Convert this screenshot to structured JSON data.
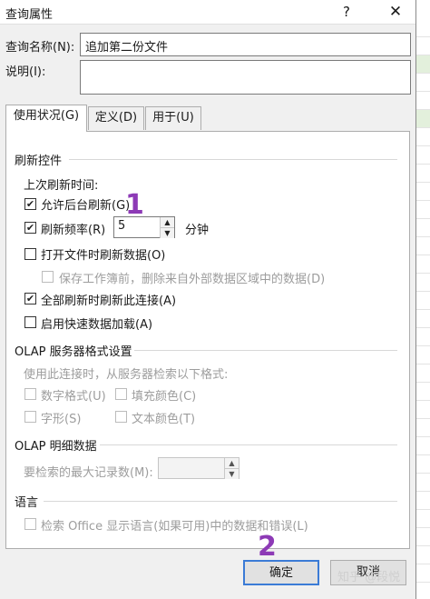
{
  "window": {
    "title": "查询属性",
    "help_label": "?",
    "close_label": "✕"
  },
  "query_name": {
    "label": "查询名称(N):",
    "value": "追加第二份文件"
  },
  "description": {
    "label": "说明(I):",
    "value": ""
  },
  "tabs": [
    {
      "label": "使用状况(G)",
      "active": true
    },
    {
      "label": "定义(D)",
      "active": false
    },
    {
      "label": "用于(U)",
      "active": false
    }
  ],
  "refresh_control": {
    "title": "刷新控件",
    "last_refresh_label": "上次刷新时间:",
    "enable_background_refresh": {
      "label": "允许后台刷新(G)",
      "checked": true
    },
    "refresh_every": {
      "label": "刷新频率(R)",
      "checked": true,
      "value": "5",
      "unit": "分钟"
    },
    "refresh_on_open": {
      "label": "打开文件时刷新数据(O)",
      "checked": false
    },
    "remove_data": {
      "label": "保存工作簿前，删除来自外部数据区域中的数据(D)",
      "checked": false,
      "disabled": true
    },
    "refresh_all": {
      "label": "全部刷新时刷新此连接(A)",
      "checked": true
    },
    "fast_load": {
      "label": "启用快速数据加载(A)",
      "checked": false
    }
  },
  "olap_format": {
    "title": "OLAP 服务器格式设置",
    "hint": "使用此连接时，从服务器检索以下格式:",
    "number_format": {
      "label": "数字格式(U)",
      "checked": false
    },
    "fill_color": {
      "label": "填充颜色(C)",
      "checked": false
    },
    "font_style": {
      "label": "字形(S)",
      "checked": false
    },
    "text_color": {
      "label": "文本颜色(T)",
      "checked": false
    }
  },
  "olap_drill": {
    "title": "OLAP 明细数据",
    "max_records_label": "要检索的最大记录数(M):",
    "max_records_value": ""
  },
  "language": {
    "title": "语言",
    "retrieve_office_lang": {
      "label": "检索 Office 显示语言(如果可用)中的数据和错误(L)",
      "checked": false
    }
  },
  "buttons": {
    "ok": "确定",
    "cancel": "取消"
  },
  "annotations": {
    "one": "1",
    "two": "2"
  },
  "watermark": "知乎 @段悦",
  "colors": {
    "accent": "#3b7bd6",
    "annotation": "#8d3ab6",
    "sheet_green": "#e3f0dc"
  }
}
